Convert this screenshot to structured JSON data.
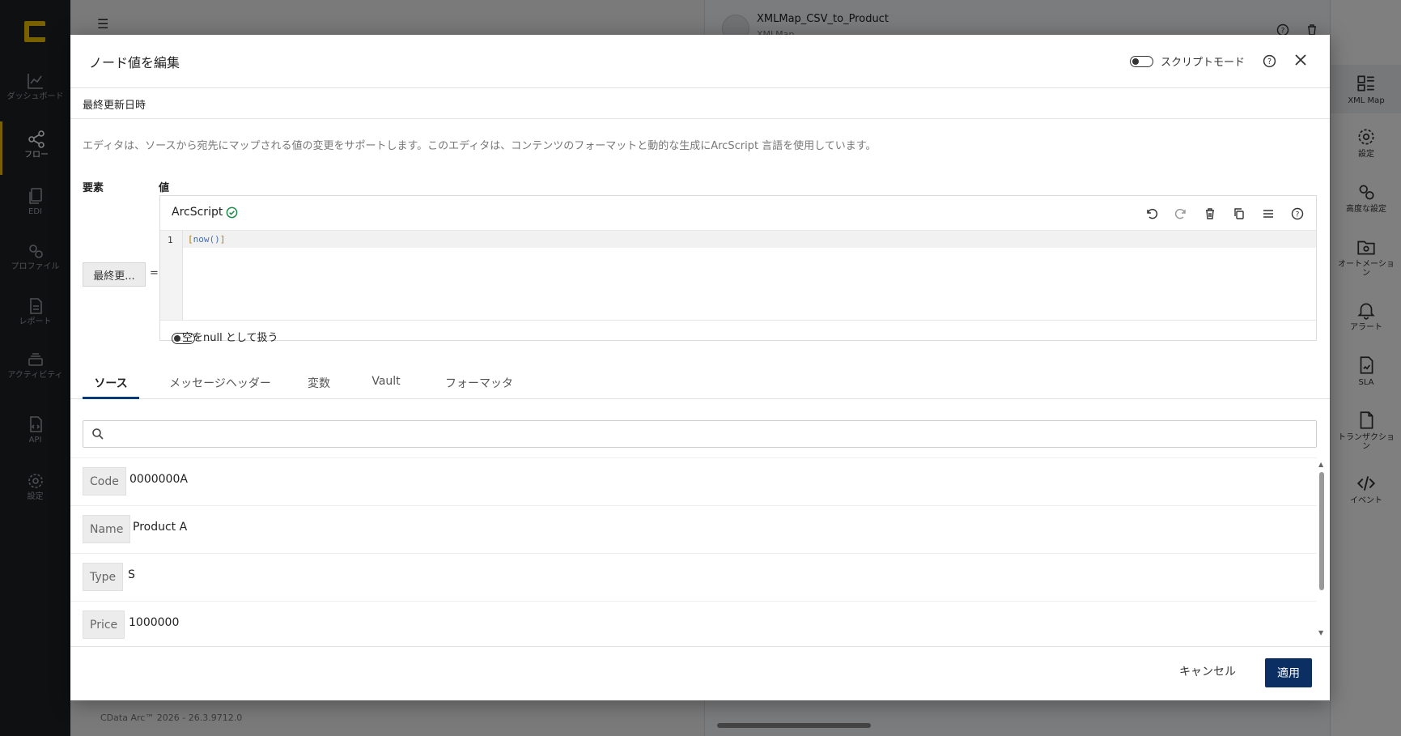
{
  "nav": {
    "items": [
      {
        "label": "ダッシュボード",
        "icon": "chart-line-icon"
      },
      {
        "label": "フロー",
        "icon": "share-nodes-icon"
      },
      {
        "label": "EDI",
        "icon": "documents-icon"
      },
      {
        "label": "プロファイル",
        "icon": "gears-icon"
      },
      {
        "label": "レポート",
        "icon": "report-icon"
      },
      {
        "label": "アクティビティ",
        "icon": "layers-icon"
      },
      {
        "label": "API",
        "icon": "api-icon"
      },
      {
        "label": "設定",
        "icon": "gear-icon"
      }
    ]
  },
  "background": {
    "flow_title": "XMLMap_CSV_to_Product",
    "flow_version": "XMLMap",
    "version_text": "CData Arc™ 2026 - 26.3.9712.0"
  },
  "right_panel": {
    "items": [
      {
        "label": "XML Map",
        "icon": "xml-map-icon"
      },
      {
        "label": "設定",
        "icon": "gear-icon"
      },
      {
        "label": "高度な設定",
        "icon": "advanced-gears-icon"
      },
      {
        "label": "オートメーション",
        "icon": "automation-icon"
      },
      {
        "label": "アラート",
        "icon": "bell-icon"
      },
      {
        "label": "SLA",
        "icon": "sla-icon"
      },
      {
        "label": "トランザクション",
        "icon": "transaction-icon"
      },
      {
        "label": "イベント",
        "icon": "code-icon"
      }
    ]
  },
  "modal": {
    "title": "ノード値を編集",
    "script_mode_label": "スクリプトモード",
    "node_name": "最終更新日時",
    "description": "エディタは、ソースから宛先にマップされる値の変更をサポートします。このエディタは、コンテンツのフォーマットと動的な生成にArcScript 言語を使用しています。",
    "element_label": "要素",
    "value_label": "値",
    "element_button": "最終更...",
    "equals": "=",
    "editor": {
      "language": "ArcScript",
      "line_number": "1",
      "code_open": "[",
      "code_fn": "now()",
      "code_close": "]"
    },
    "null_label": "空をnull として扱う",
    "tabs": [
      "ソース",
      "メッセージヘッダー",
      "変数",
      "Vault",
      "フォーマッタ"
    ],
    "search_placeholder": "",
    "rows": [
      {
        "key": "Code",
        "value": "0000000A"
      },
      {
        "key": "Name",
        "value": "Product A"
      },
      {
        "key": "Type",
        "value": "S"
      },
      {
        "key": "Price",
        "value": "1000000"
      }
    ],
    "cancel_label": "キャンセル",
    "apply_label": "適用"
  },
  "colors": {
    "accent": "#f2c200",
    "apply_button": "#0b2f63",
    "tab_underline": "#0a3a7a",
    "valid_check": "#1e8a4a"
  }
}
